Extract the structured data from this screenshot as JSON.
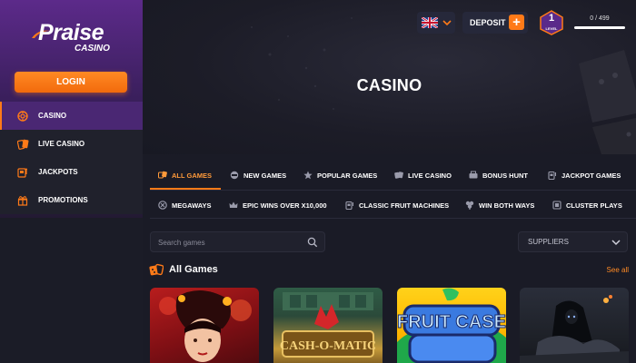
{
  "brand": {
    "name": "Praise",
    "sub": "CASINO"
  },
  "sidebar": {
    "login_label": "LOGIN",
    "items": [
      {
        "label": "CASINO",
        "icon": "casino-chip-icon",
        "active": true
      },
      {
        "label": "LIVE CASINO",
        "icon": "cards-icon",
        "active": false
      },
      {
        "label": "JACKPOTS",
        "icon": "slot-machine-icon",
        "active": false
      },
      {
        "label": "PROMOTIONS",
        "icon": "gift-icon",
        "active": false
      }
    ]
  },
  "header": {
    "language_flag": "uk-flag-icon",
    "deposit_label": "DEPOSIT",
    "deposit_plus": "+",
    "level_number": "1",
    "level_label": "LEVEL",
    "xp_text": "0 / 499",
    "xp_progress": 0
  },
  "hero": {
    "title": "CASINO"
  },
  "tabs_row1": [
    {
      "label": "ALL GAMES",
      "icon": "all-games-icon",
      "active": true
    },
    {
      "label": "NEW GAMES",
      "icon": "new-games-icon",
      "active": false
    },
    {
      "label": "POPULAR GAMES",
      "icon": "star-icon",
      "active": false
    },
    {
      "label": "LIVE CASINO",
      "icon": "live-casino-icon",
      "active": false
    },
    {
      "label": "BONUS HUNT",
      "icon": "bonus-hunt-icon",
      "active": false
    },
    {
      "label": "JACKPOT GAMES",
      "icon": "jackpot-icon",
      "active": false
    }
  ],
  "tabs_row2": [
    {
      "label": "MEGAWAYS",
      "icon": "megaways-icon"
    },
    {
      "label": "EPIC WINS OVER X10,000",
      "icon": "crown-icon"
    },
    {
      "label": "CLASSIC FRUIT MACHINES",
      "icon": "fruit-machine-icon"
    },
    {
      "label": "WIN BOTH WAYS",
      "icon": "both-ways-icon"
    },
    {
      "label": "CLUSTER PLAYS",
      "icon": "cluster-icon"
    }
  ],
  "search": {
    "placeholder": "Search games"
  },
  "suppliers": {
    "label": "SUPPLIERS"
  },
  "section": {
    "title": "All Games",
    "see_all": "See all"
  },
  "games": [
    {
      "title": "",
      "art": "red-geisha"
    },
    {
      "title": "CASH-O-MATIC",
      "art": "cash-o-matic"
    },
    {
      "title": "FRUIT CASE",
      "art": "fruit-case"
    },
    {
      "title": "",
      "art": "dark-knight"
    }
  ],
  "colors": {
    "accent": "#ff7a18",
    "bg": "#1a1b26",
    "sidebar_active": "#4a2773"
  }
}
